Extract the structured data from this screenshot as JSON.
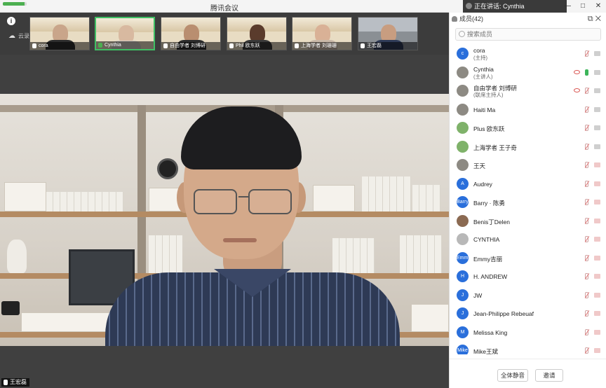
{
  "window": {
    "title": "腾讯会议",
    "speaker": "正在讲话: Cynthia",
    "controls": [
      "—",
      "□",
      "✕"
    ],
    "progress": 0.9
  },
  "strip": {
    "cloud_label": "云录"
  },
  "thumbnails": [
    {
      "label": "cora",
      "mic_on": false
    },
    {
      "label": "Cynthia",
      "mic_on": true
    },
    {
      "label": "自由学者 刘博研",
      "mic_on": false
    },
    {
      "label": "Phil 欧东跃",
      "mic_on": false
    },
    {
      "label": "上海学者 刘珊珊",
      "mic_on": false
    },
    {
      "label": "王宏磊",
      "mic_on": false
    }
  ],
  "main_video": {
    "name": "王宏磊"
  },
  "panel": {
    "title": "成员(42)",
    "search_placeholder": "搜索成员",
    "participants": [
      {
        "name": "cora",
        "sub": "(主持)",
        "avatar": "c"
      },
      {
        "name": "Cynthia",
        "sub": "(主讲人)",
        "avatar": "",
        "eye": true,
        "mic_on": true
      },
      {
        "name": "自由学者 刘博研",
        "sub": "(联席主持人)",
        "avatar": "",
        "eye": true
      },
      {
        "name": "Haiti Ma",
        "sub": "",
        "avatar": ""
      },
      {
        "name": "Plus 欧东跃",
        "sub": "",
        "avatar": ""
      },
      {
        "name": "上海学者 王子奇",
        "sub": "",
        "avatar": ""
      },
      {
        "name": "王天",
        "sub": "",
        "avatar": ""
      },
      {
        "name": "Audrey",
        "sub": "",
        "avatar": "A"
      },
      {
        "name": "Barry · 陈勇",
        "sub": "",
        "avatar": "Barry"
      },
      {
        "name": "Benis丁Delen",
        "sub": "",
        "avatar": ""
      },
      {
        "name": "CYNTHIA",
        "sub": "",
        "avatar": ""
      },
      {
        "name": "Emmy吉丽",
        "sub": "",
        "avatar": "Emmy"
      },
      {
        "name": "H. ANDREW",
        "sub": "",
        "avatar": "H"
      },
      {
        "name": "JW",
        "sub": "",
        "avatar": "J"
      },
      {
        "name": "Jean-Philippe Rebeuaf",
        "sub": "",
        "avatar": "J"
      },
      {
        "name": "Melissa King",
        "sub": "",
        "avatar": "M"
      },
      {
        "name": "Mike王斌",
        "sub": "",
        "avatar": "Mike"
      }
    ],
    "footer": {
      "mute_all": "全体静音",
      "invite": "邀请"
    }
  }
}
